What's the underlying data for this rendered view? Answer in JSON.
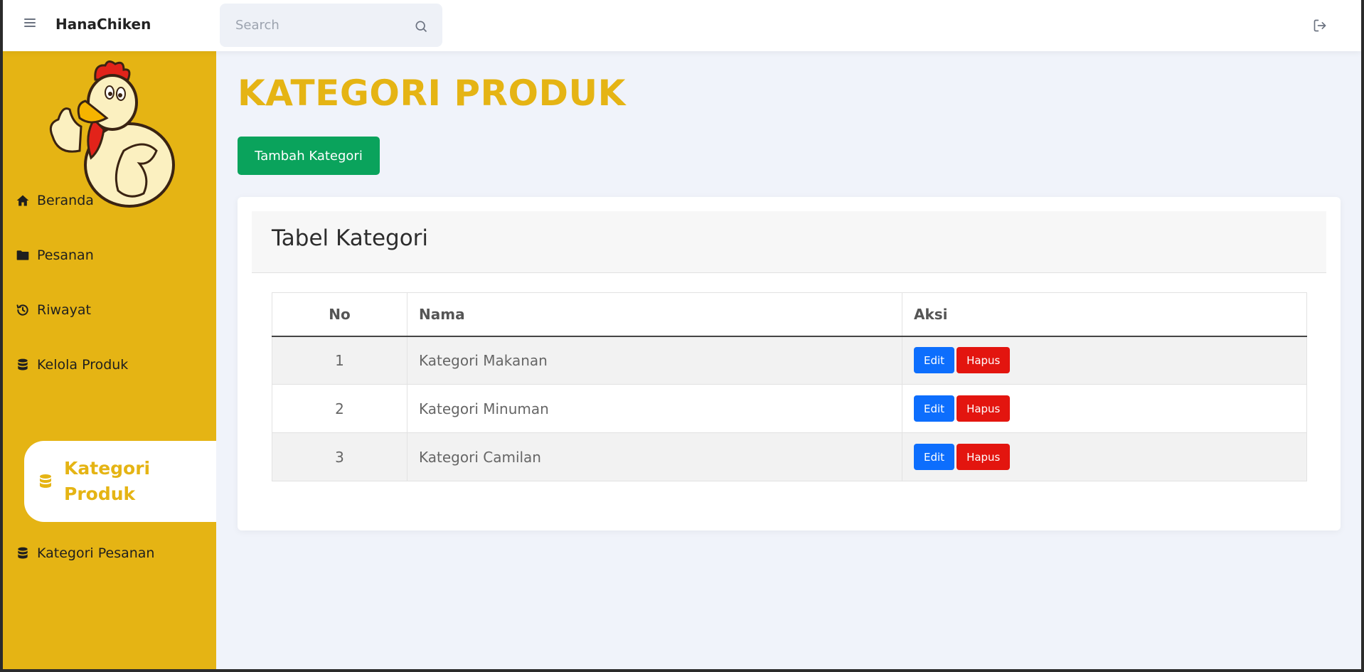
{
  "topbar": {
    "brand": "HanaChiken",
    "search_placeholder": "Search"
  },
  "sidebar": {
    "items": [
      {
        "label": "Beranda",
        "icon": "home-icon"
      },
      {
        "label": "Pesanan",
        "icon": "folder-icon"
      },
      {
        "label": "Riwayat",
        "icon": "history-icon"
      },
      {
        "label": "Kelola Produk",
        "icon": "database-icon"
      },
      {
        "label": "Kategori Produk",
        "icon": "database-icon",
        "active": true
      },
      {
        "label": "Kategori Pesanan",
        "icon": "database-icon"
      }
    ]
  },
  "main": {
    "title": "KATEGORI PRODUK",
    "add_button": "Tambah Kategori",
    "card_title": "Tabel Kategori",
    "table": {
      "headers": [
        "No",
        "Nama",
        "Aksi"
      ],
      "rows": [
        {
          "no": "1",
          "nama": "Kategori Makanan"
        },
        {
          "no": "2",
          "nama": "Kategori Minuman"
        },
        {
          "no": "3",
          "nama": "Kategori Camilan"
        }
      ],
      "edit_label": "Edit",
      "delete_label": "Hapus"
    }
  },
  "colors": {
    "accent": "#e5b414",
    "add_button": "#0aa35c",
    "edit_button": "#0d6efd",
    "delete_button": "#e3150f"
  }
}
